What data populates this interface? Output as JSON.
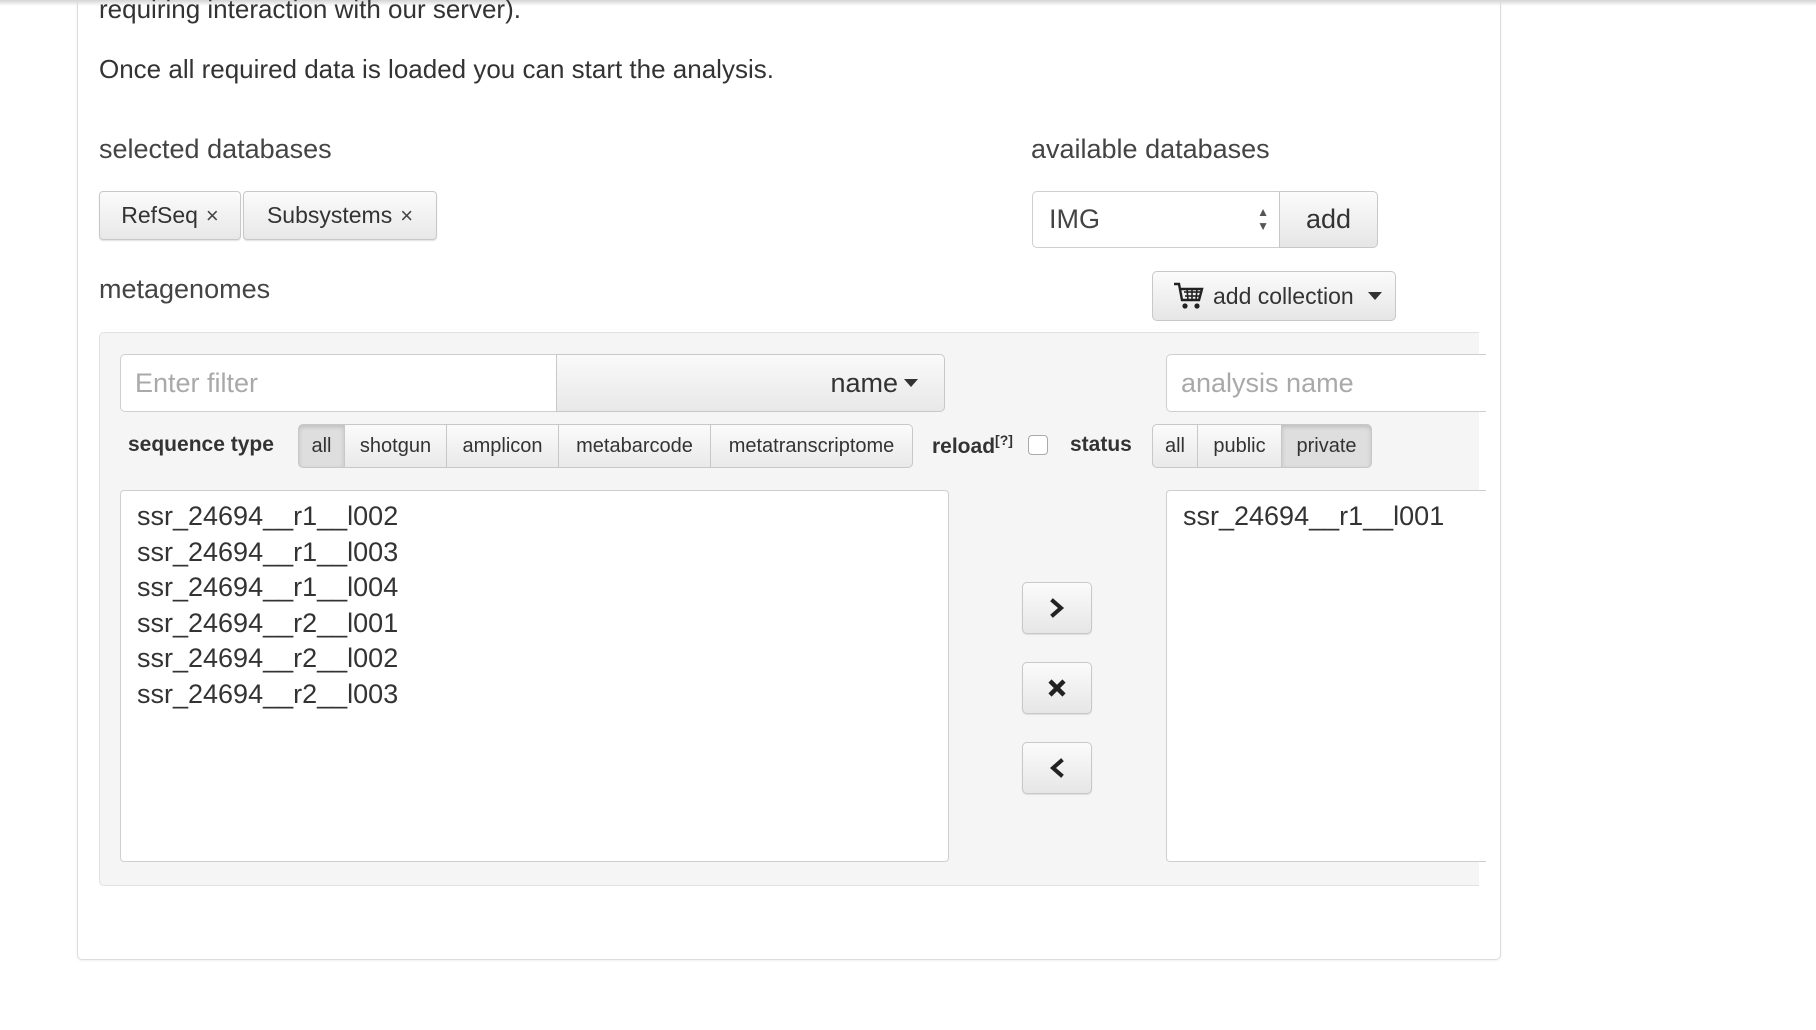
{
  "intro": {
    "line1": "requiring interaction with our server).",
    "line2": "Once all required data is loaded you can start the analysis."
  },
  "selected_databases": {
    "label": "selected databases",
    "chips": [
      {
        "label": "RefSeq",
        "remove": "×"
      },
      {
        "label": "Subsystems",
        "remove": "×"
      }
    ]
  },
  "available_databases": {
    "label": "available databases",
    "selected": "IMG",
    "add_label": "add"
  },
  "metagenomes": {
    "label": "metagenomes",
    "add_collection_label": "add collection",
    "filter_placeholder": "Enter filter",
    "sort_label": "name",
    "analysis_name_placeholder": "analysis name",
    "sequence_type": {
      "label": "sequence type",
      "options": [
        "all",
        "shotgun",
        "amplicon",
        "metabarcode",
        "metatranscriptome"
      ],
      "active": "all"
    },
    "reload_label": "reload",
    "reload_help": "[?]",
    "status": {
      "label": "status",
      "options": [
        "all",
        "public",
        "private"
      ],
      "active": "private"
    },
    "available_list": [
      "ssr_24694__r1__l002",
      "ssr_24694__r1__l003",
      "ssr_24694__r1__l004",
      "ssr_24694__r2__l001",
      "ssr_24694__r2__l002",
      "ssr_24694__r2__l003"
    ],
    "selected_list": [
      "ssr_24694__r1__l001"
    ]
  },
  "icons": {
    "cart": "cart-icon",
    "move_right": "chevron-right-icon",
    "remove": "close-icon",
    "move_left": "chevron-left-icon"
  }
}
